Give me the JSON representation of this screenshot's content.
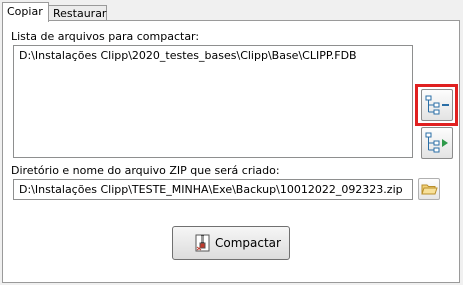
{
  "tabs": [
    {
      "label": "Copiar",
      "active": true
    },
    {
      "label": "Restaurar",
      "active": false
    }
  ],
  "files_section": {
    "label": "Lista de arquivos para compactar:",
    "items": [
      "D:\\Instalações Clipp\\2020_testes_bases\\Clipp\\Base\\CLIPP.FDB"
    ]
  },
  "side_buttons": {
    "add_icon": "tree-add-icon",
    "move_icon": "tree-move-icon"
  },
  "zip_section": {
    "label": "Diretório e nome do arquivo ZIP que será criado:",
    "value": "D:\\Instalações Clipp\\TESTE_MINHA\\Exe\\Backup\\10012022_092323.zip",
    "browse_icon": "folder-icon"
  },
  "action": {
    "label": "Compactar",
    "icon": "zip-archive-icon"
  },
  "colors": {
    "highlight": "#e02020",
    "panel": "#ffffff",
    "window": "#f0f0f0"
  }
}
